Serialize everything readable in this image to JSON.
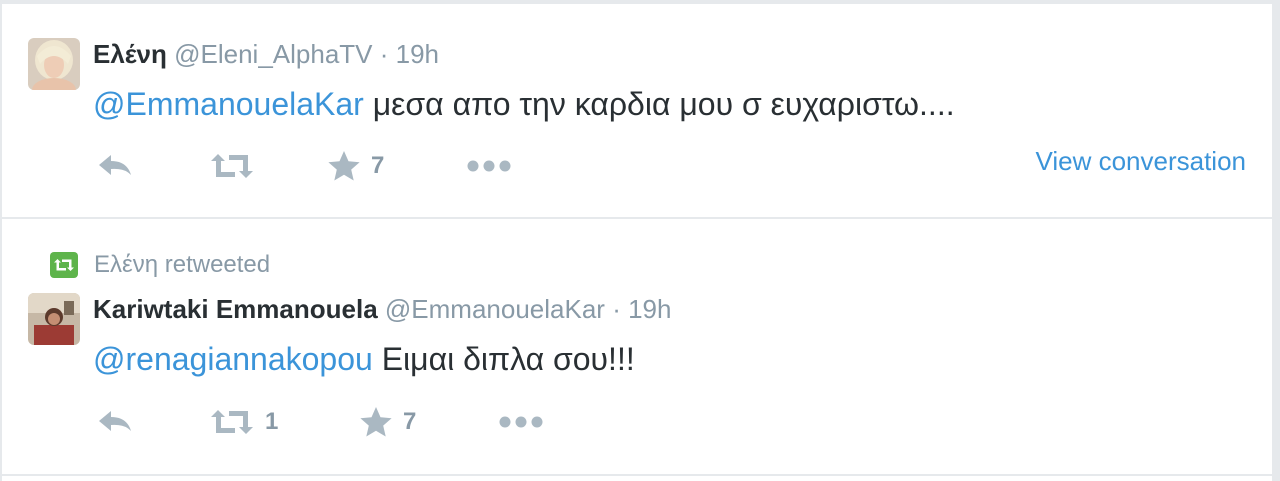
{
  "tweets": [
    {
      "author": {
        "name": "Ελένη",
        "handle": "@Eleni_AlphaTV",
        "time": "19h"
      },
      "separator": "·",
      "mention": "@EmmanouelaKar",
      "text": " μεσα απο την καρδια μου σ ευχαριστω....",
      "retweet_count": "",
      "favorite_count": "7",
      "view_conversation": "View conversation"
    },
    {
      "retweeted_by": "Ελένη retweeted",
      "author": {
        "name": "Kariwtaki Emmanouela",
        "handle": "@EmmanouelaKar",
        "time": "19h"
      },
      "separator": "·",
      "mention": "@renagiannakopou",
      "text": " Ειμαι διπλα σου!!!",
      "retweet_count": "1",
      "favorite_count": "7"
    }
  ],
  "colors": {
    "link": "#3b94d9",
    "icon": "#aab8c2",
    "meta": "#8899a6",
    "text": "#292f33",
    "retweet_badge": "#5eb44b"
  },
  "icons": [
    "reply-icon",
    "retweet-icon",
    "favorite-star-icon",
    "more-dots-icon",
    "retweeted-badge-icon"
  ]
}
